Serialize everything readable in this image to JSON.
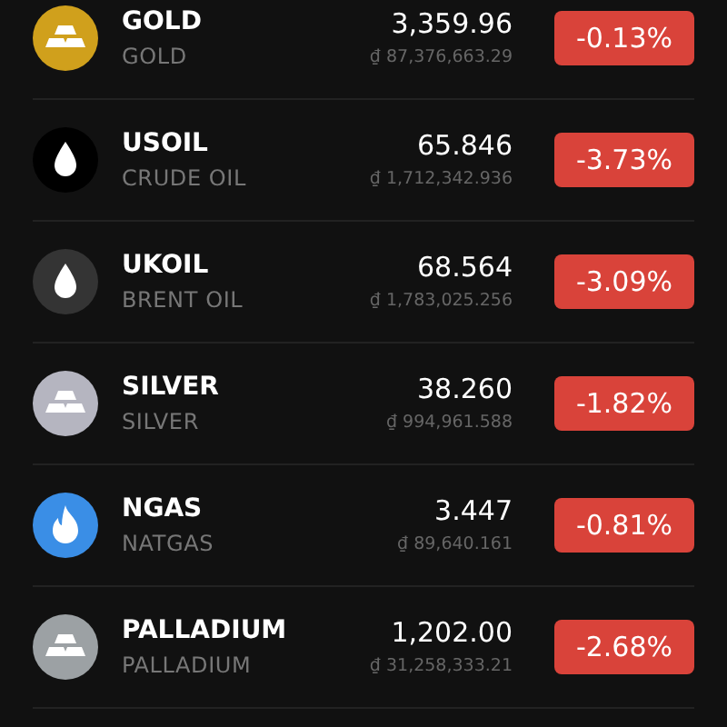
{
  "assets": [
    {
      "symbol": "GOLD",
      "name": "GOLD",
      "price": "3,359.96",
      "local_price": "₫ 87,376,663.29",
      "change": "-0.13%",
      "kind": "bars",
      "color": "#d0a01c"
    },
    {
      "symbol": "USOIL",
      "name": "CRUDE OIL",
      "price": "65.846",
      "local_price": "₫ 1,712,342.936",
      "change": "-3.73%",
      "kind": "drop",
      "color": "#000000"
    },
    {
      "symbol": "UKOIL",
      "name": "BRENT OIL",
      "price": "68.564",
      "local_price": "₫ 1,783,025.256",
      "change": "-3.09%",
      "kind": "drop",
      "color": "#343434"
    },
    {
      "symbol": "SILVER",
      "name": "SILVER",
      "price": "38.260",
      "local_price": "₫ 994,961.588",
      "change": "-1.82%",
      "kind": "bars",
      "color": "#b5b5c0"
    },
    {
      "symbol": "NGAS",
      "name": "NATGAS",
      "price": "3.447",
      "local_price": "₫ 89,640.161",
      "change": "-0.81%",
      "kind": "flame",
      "color": "#3a8ee6"
    },
    {
      "symbol": "PALLADIUM",
      "name": "PALLADIUM",
      "price": "1,202.00",
      "local_price": "₫ 31,258,333.21",
      "change": "-2.68%",
      "kind": "bars",
      "color": "#9ca1a4"
    }
  ]
}
